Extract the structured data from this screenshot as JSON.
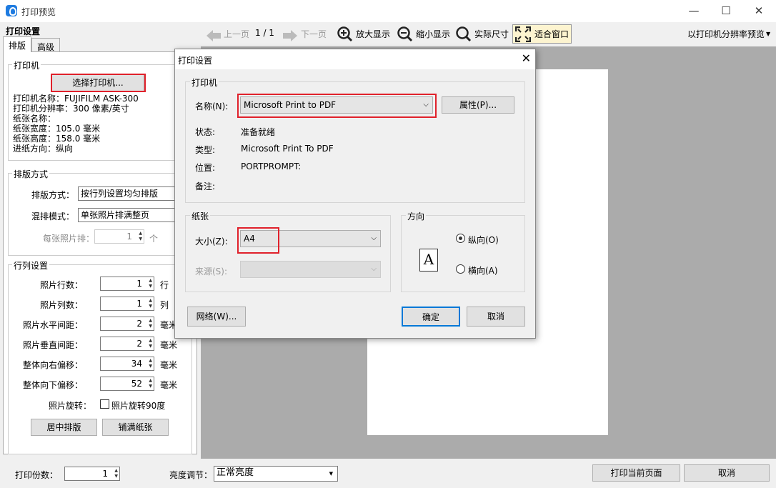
{
  "window": {
    "title": "打印预览",
    "minimize": "—",
    "maximize": "☐",
    "close": "✕"
  },
  "left": {
    "section_title": "打印设置",
    "tabs": [
      "排版",
      "高级"
    ],
    "printer": {
      "group": "打印机",
      "select_button": "选择打印机...",
      "info": [
        "打印机名称：FUJIFILM ASK-300",
        "打印机分辨率：300 像素/英寸",
        "纸张名称：",
        "纸张宽度：105.0 毫米",
        "纸张高度：158.0 毫米",
        "进纸方向：纵向"
      ]
    },
    "layout": {
      "group": "排版方式",
      "mode_label": "排版方式：",
      "mode_value": "按行列设置均匀排版",
      "mix_label": "混排模式：",
      "mix_value": "单张照片排满整页",
      "per_label": "每张照片排：",
      "per_value": "1",
      "per_unit": "个"
    },
    "grid": {
      "group": "行列设置",
      "rows": [
        {
          "label": "照片行数：",
          "value": "1",
          "unit": "行"
        },
        {
          "label": "照片列数：",
          "value": "1",
          "unit": "列"
        },
        {
          "label": "照片水平间距：",
          "value": "2",
          "unit": "毫米"
        },
        {
          "label": "照片垂直间距：",
          "value": "2",
          "unit": "毫米"
        },
        {
          "label": "整体向右偏移：",
          "value": "34",
          "unit": "毫米"
        },
        {
          "label": "整体向下偏移：",
          "value": "52",
          "unit": "毫米"
        }
      ],
      "rotate_label": "照片旋转：",
      "rotate_check": "照片旋转90度",
      "center_button": "居中排版",
      "fill_button": "铺满纸张"
    }
  },
  "toolbar": {
    "prev": "上一页",
    "page": "1 / 1",
    "next": "下一页",
    "zoom_in": "放大显示",
    "zoom_out": "缩小显示",
    "actual": "实际尺寸",
    "fit": "适合窗口",
    "mode": "以打印机分辨率预览"
  },
  "bottom": {
    "copies_label": "打印份数：",
    "copies_value": "1",
    "brightness_label": "亮度调节：",
    "brightness_value": "正常亮度",
    "print_button": "打印当前页面",
    "cancel_button": "取消"
  },
  "dialog": {
    "title": "打印设置",
    "close": "✕",
    "printer_group": "打印机",
    "name_label": "名称(N):",
    "name_value": "Microsoft Print to PDF",
    "props_button": "属性(P)...",
    "status_label": "状态:",
    "status_value": "准备就绪",
    "type_label": "类型:",
    "type_value": "Microsoft Print To PDF",
    "where_label": "位置:",
    "where_value": "PORTPROMPT:",
    "comment_label": "备注:",
    "comment_value": "",
    "paper_group": "纸张",
    "size_label": "大小(Z):",
    "size_value": "A4",
    "source_label": "来源(S):",
    "source_value": "",
    "orient_group": "方向",
    "portrait": "纵向(O)",
    "landscape": "横向(A)",
    "orient_icon": "A",
    "network_button": "网络(W)...",
    "ok_button": "确定",
    "cancel_button": "取消"
  }
}
